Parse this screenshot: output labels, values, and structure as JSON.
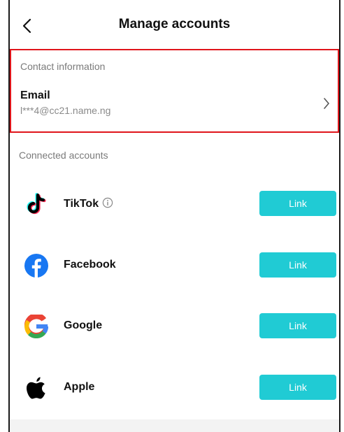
{
  "header": {
    "title": "Manage accounts",
    "back_icon": "chevron-left-icon"
  },
  "contact": {
    "section_label": "Contact information",
    "email": {
      "label": "Email",
      "value": "l***4@cc21.name.ng",
      "icon": "chevron-right-icon"
    },
    "highlight_color": "#e0151b"
  },
  "connected": {
    "section_label": "Connected accounts",
    "accounts": [
      {
        "name": "TikTok",
        "icon": "tiktok-icon",
        "info_icon": "info-icon",
        "button": "Link"
      },
      {
        "name": "Facebook",
        "icon": "facebook-icon",
        "button": "Link"
      },
      {
        "name": "Google",
        "icon": "google-icon",
        "button": "Link"
      },
      {
        "name": "Apple",
        "icon": "apple-icon",
        "button": "Link"
      }
    ]
  },
  "colors": {
    "accent": "#20cbd4",
    "facebook": "#1877f2",
    "label_gray": "#7a7a7a"
  }
}
